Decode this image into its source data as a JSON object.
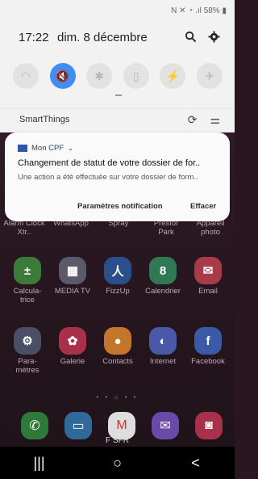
{
  "status_bar": {
    "icons": "N ✕ ◔ .ıl",
    "battery": "58%"
  },
  "header": {
    "time": "17:22",
    "date": "dim. 8 décembre"
  },
  "quick_settings": [
    {
      "icon": "wifi-icon",
      "glyph": "◠",
      "active": false
    },
    {
      "icon": "sound-mute-icon",
      "glyph": "🔇",
      "active": true
    },
    {
      "icon": "bluetooth-icon",
      "glyph": "✱",
      "active": false
    },
    {
      "icon": "rotation-icon",
      "glyph": "▯",
      "active": false
    },
    {
      "icon": "flashlight-icon",
      "glyph": "⚡",
      "active": false
    },
    {
      "icon": "airplane-icon",
      "glyph": "✈",
      "active": false
    }
  ],
  "smartthings": {
    "label": "SmartThings"
  },
  "notification": {
    "app_name": "Mon CPF",
    "title": "Changement de statut de votre dossier de for..",
    "body": "Une action a été effectuée sur votre dossier de form..",
    "actions": {
      "settings": "Paramètres notification",
      "clear": "Effacer"
    }
  },
  "home_apps": {
    "row1": [
      {
        "label": "Alarm Clock Xtr..",
        "color": "#3b2a33"
      },
      {
        "label": "WhatsApp",
        "color": "#3b2a33"
      },
      {
        "label": "Spray",
        "color": "#3b2a33"
      },
      {
        "label": "Prestor Park",
        "color": "#3b2a33"
      },
      {
        "label": "Appareil photo",
        "color": "#3b2a33"
      }
    ],
    "row2": [
      {
        "label": "Calcula-trice",
        "glyph": "±",
        "color": "#3b7a3a"
      },
      {
        "label": "MEDIA TV",
        "glyph": "▦",
        "color": "#5a5a6a"
      },
      {
        "label": "FizzUp",
        "glyph": "人",
        "color": "#2b4f8a"
      },
      {
        "label": "Calendrier",
        "glyph": "8",
        "color": "#2f7a55"
      },
      {
        "label": "Email",
        "glyph": "✉",
        "color": "#a83a4a"
      }
    ],
    "row3": [
      {
        "label": "Para-mètres",
        "glyph": "⚙",
        "color": "#4a4f66"
      },
      {
        "label": "Galerie",
        "glyph": "✿",
        "color": "#a8304a"
      },
      {
        "label": "Contacts",
        "glyph": "●",
        "color": "#c4762a"
      },
      {
        "label": "Internet",
        "glyph": "◐",
        "color": "#4a58a8"
      },
      {
        "label": "Facebook",
        "glyph": "f",
        "color": "#3a5aa8"
      }
    ],
    "dock": [
      {
        "glyph": "✆",
        "color": "#2f7a3a"
      },
      {
        "glyph": "▭",
        "color": "#2f6a9a"
      },
      {
        "glyph": "M",
        "color": "#ddd"
      },
      {
        "glyph": "✉",
        "color": "#6a4aa8"
      },
      {
        "glyph": "◙",
        "color": "#a8304a"
      }
    ]
  },
  "carrier": "F SFR",
  "navigation": {
    "recents": "|||",
    "home": "○",
    "back": "<"
  }
}
